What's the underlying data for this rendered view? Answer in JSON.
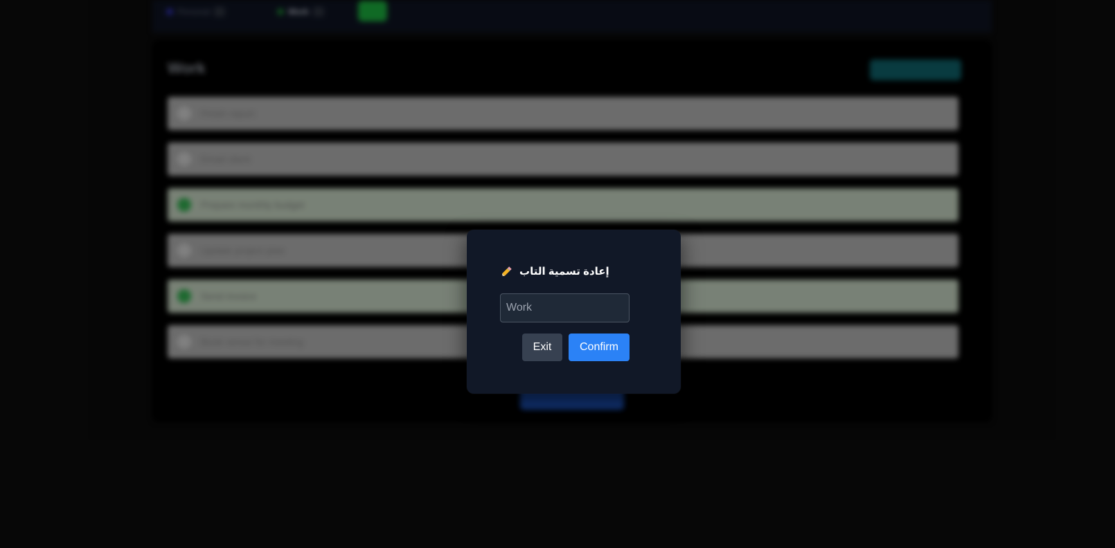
{
  "background": {
    "tabs": [
      {
        "label": "Personal"
      },
      {
        "label": "Work"
      }
    ],
    "panel_title": "Work",
    "tasks": [
      {
        "label": "Finish report",
        "done": false
      },
      {
        "label": "Email client",
        "done": false
      },
      {
        "label": "Prepare monthly budget",
        "done": true
      },
      {
        "label": "Update project plan",
        "done": false
      },
      {
        "label": "Send invoice",
        "done": true
      },
      {
        "label": "Book venue for meeting",
        "done": false
      }
    ]
  },
  "dialog": {
    "title": "إعادة تسمية التاب",
    "input_value": "",
    "input_placeholder": "Work",
    "exit_label": "Exit",
    "confirm_label": "Confirm"
  },
  "colors": {
    "modal_bg": "#111827",
    "confirm": "#2b82f6",
    "exit": "#374151",
    "done_check": "#2fa24a"
  },
  "icons": {
    "title_icon": "pencil-icon"
  }
}
